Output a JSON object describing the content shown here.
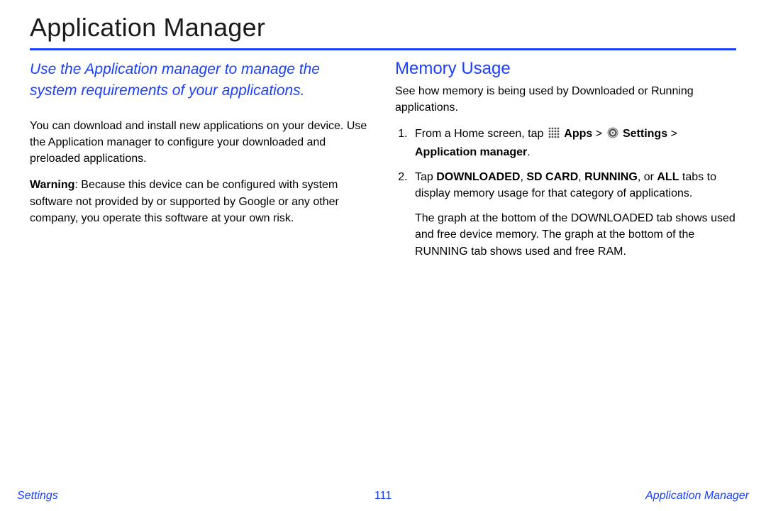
{
  "title": "Application Manager",
  "intro": "Use the Application manager to manage the system requirements of your applications.",
  "leftCol": {
    "p1": "You can download and install new applications on your device. Use the Application manager to configure your downloaded and preloaded applications.",
    "warnLabel": "Warning",
    "warnText": ": Because this device can be configured with system software not provided by or supported by Google or any other company, you operate this software at your own risk."
  },
  "rightCol": {
    "heading": "Memory Usage",
    "lead": "See how memory is being used by Downloaded or Running applications.",
    "step1": {
      "prefix": "From a Home screen, tap ",
      "apps": "Apps",
      "gt1": " > ",
      "settings": "Settings",
      "gt2": " > ",
      "appmgr": "Application manager",
      "period": "."
    },
    "step2": {
      "prefix": "Tap ",
      "d": "DOWNLOADED",
      "c1": ", ",
      "s": "SD CARD",
      "c2": ", ",
      "r": "RUNNING",
      "c3": ", or ",
      "a": "ALL",
      "rest": " tabs to display memory usage for that category of applications.",
      "after": "The graph at the bottom of the DOWNLOADED tab shows used and free device memory. The graph at the bottom of the RUNNING tab shows used and free RAM."
    }
  },
  "footer": {
    "left": "Settings",
    "center": "111",
    "right": "Application Manager"
  }
}
